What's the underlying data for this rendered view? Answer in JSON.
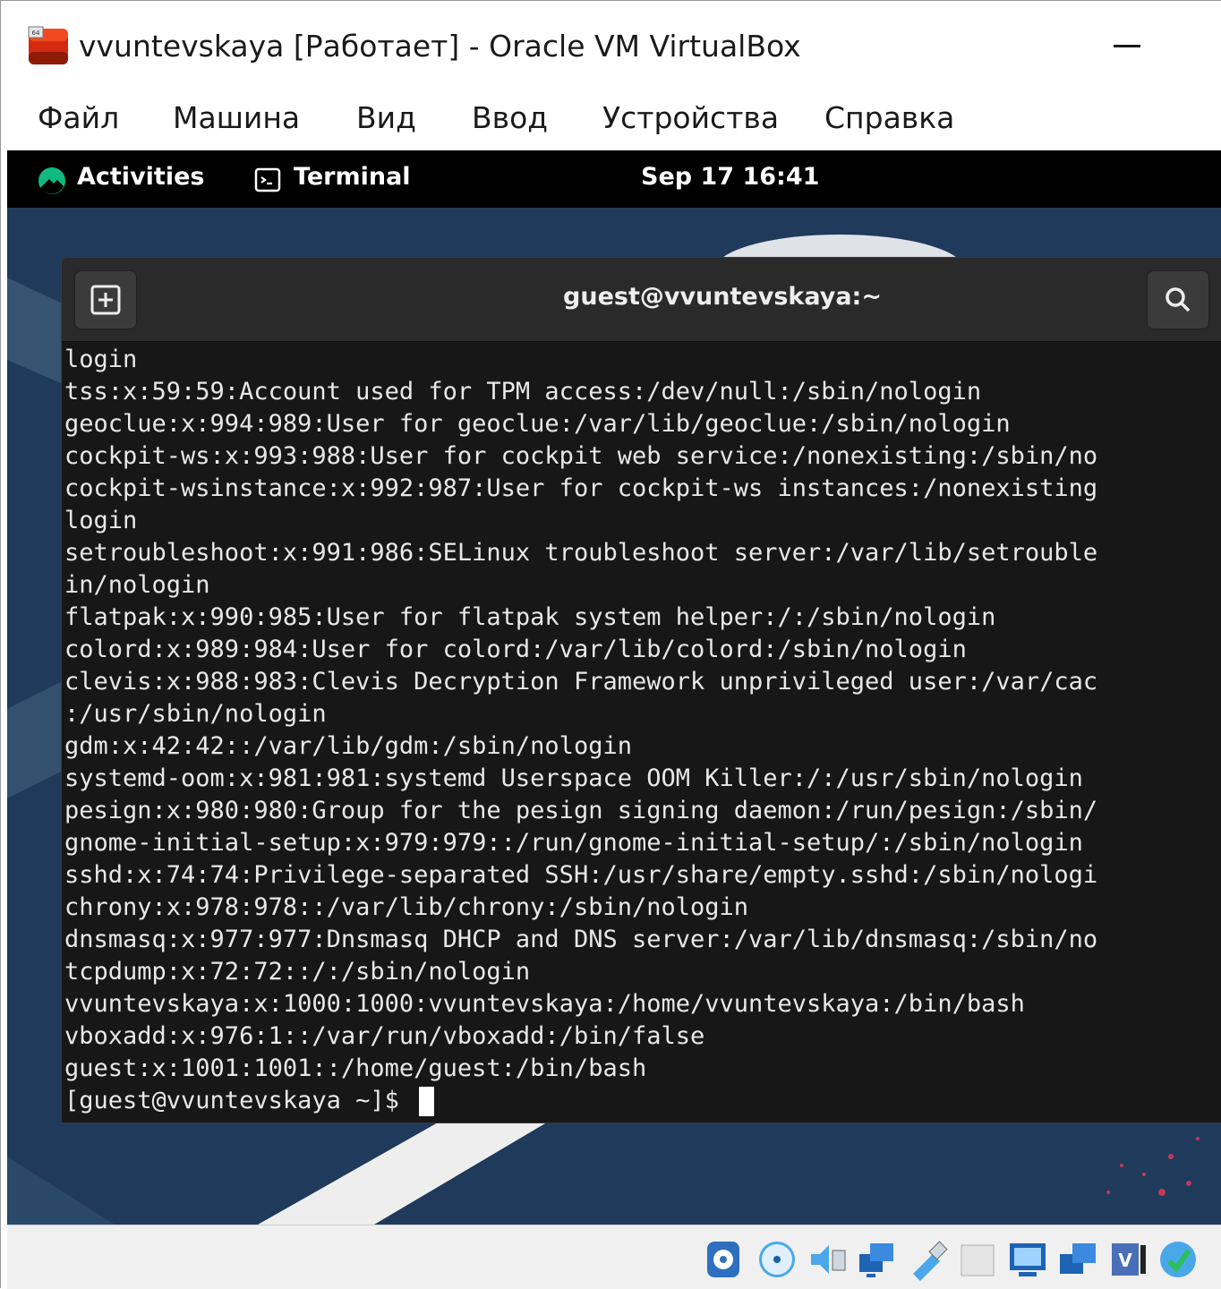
{
  "window": {
    "title": "vvuntevskaya [Работает] - Oracle VM VirtualBox"
  },
  "menu": {
    "items": [
      "Файл",
      "Машина",
      "Вид",
      "Ввод",
      "Устройства",
      "Справка"
    ]
  },
  "gnome_topbar": {
    "activities": "Activities",
    "app_name": "Terminal",
    "clock": "Sep 17  16:41"
  },
  "terminal": {
    "title": "guest@vvuntevskaya:~",
    "lines": [
      "login",
      "tss:x:59:59:Account used for TPM access:/dev/null:/sbin/nologin",
      "geoclue:x:994:989:User for geoclue:/var/lib/geoclue:/sbin/nologin",
      "cockpit-ws:x:993:988:User for cockpit web service:/nonexisting:/sbin/no",
      "cockpit-wsinstance:x:992:987:User for cockpit-ws instances:/nonexisting",
      "login",
      "setroubleshoot:x:991:986:SELinux troubleshoot server:/var/lib/setrouble",
      "in/nologin",
      "flatpak:x:990:985:User for flatpak system helper:/:/sbin/nologin",
      "colord:x:989:984:User for colord:/var/lib/colord:/sbin/nologin",
      "clevis:x:988:983:Clevis Decryption Framework unprivileged user:/var/cac",
      ":/usr/sbin/nologin",
      "gdm:x:42:42::/var/lib/gdm:/sbin/nologin",
      "systemd-oom:x:981:981:systemd Userspace OOM Killer:/:/usr/sbin/nologin",
      "pesign:x:980:980:Group for the pesign signing daemon:/run/pesign:/sbin/",
      "gnome-initial-setup:x:979:979::/run/gnome-initial-setup/:/sbin/nologin",
      "sshd:x:74:74:Privilege-separated SSH:/usr/share/empty.sshd:/sbin/nologi",
      "chrony:x:978:978::/var/lib/chrony:/sbin/nologin",
      "dnsmasq:x:977:977:Dnsmasq DHCP and DNS server:/var/lib/dnsmasq:/sbin/no",
      "tcpdump:x:72:72::/:/sbin/nologin",
      "vvuntevskaya:x:1000:1000:vvuntevskaya:/home/vvuntevskaya:/bin/bash",
      "vboxadd:x:976:1::/var/run/vboxadd:/bin/false",
      "guest:x:1001:1001::/home/guest:/bin/bash"
    ],
    "prompt": "[guest@vvuntevskaya ~]$ "
  },
  "statusbar": {
    "icons": [
      "hard-disk-icon",
      "optical-drive-icon",
      "audio-icon",
      "network-icon",
      "usb-icon",
      "shared-folders-icon",
      "display-icon",
      "recording-icon",
      "cpu-icon",
      "mouse-integration-icon"
    ]
  },
  "colors": {
    "guest_desktop": "#1f3a5a",
    "terminal_bg": "#171717",
    "gnome_topbar": "#000000"
  }
}
